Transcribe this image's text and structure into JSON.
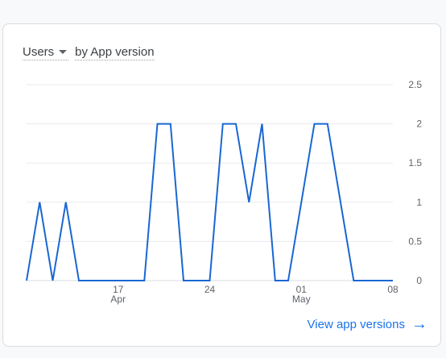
{
  "card": {
    "metric_label": "Users",
    "dimension_label": "by App version",
    "link_label": "View app versions"
  },
  "chart_data": {
    "type": "line",
    "title": "",
    "xlabel": "",
    "ylabel": "",
    "ylim": [
      0,
      2.5
    ],
    "y_ticks": [
      "2.5",
      "2",
      "1.5",
      "1",
      "0.5",
      "0"
    ],
    "x_tick_labels": [
      {
        "day": "17",
        "month": "Apr",
        "index": 7
      },
      {
        "day": "24",
        "month": "",
        "index": 14
      },
      {
        "day": "01",
        "month": "May",
        "index": 21
      },
      {
        "day": "08",
        "month": "",
        "index": 28
      }
    ],
    "x": [
      "Apr 10",
      "Apr 11",
      "Apr 12",
      "Apr 13",
      "Apr 14",
      "Apr 15",
      "Apr 16",
      "Apr 17",
      "Apr 18",
      "Apr 19",
      "Apr 20",
      "Apr 21",
      "Apr 22",
      "Apr 23",
      "Apr 24",
      "Apr 25",
      "Apr 26",
      "Apr 27",
      "Apr 28",
      "Apr 29",
      "Apr 30",
      "May 01",
      "May 02",
      "May 03",
      "May 04",
      "May 05",
      "May 06",
      "May 07",
      "May 08"
    ],
    "series": [
      {
        "values": [
          0,
          1,
          0,
          1,
          0,
          0,
          0,
          0,
          0,
          0,
          2,
          2,
          0,
          0,
          0,
          2,
          2,
          1,
          2,
          0,
          0,
          1,
          2,
          2,
          1,
          0,
          0,
          0,
          0
        ]
      }
    ],
    "colors": {
      "line": "#1967d2",
      "grid": "#e8eaed"
    },
    "grid": true
  }
}
